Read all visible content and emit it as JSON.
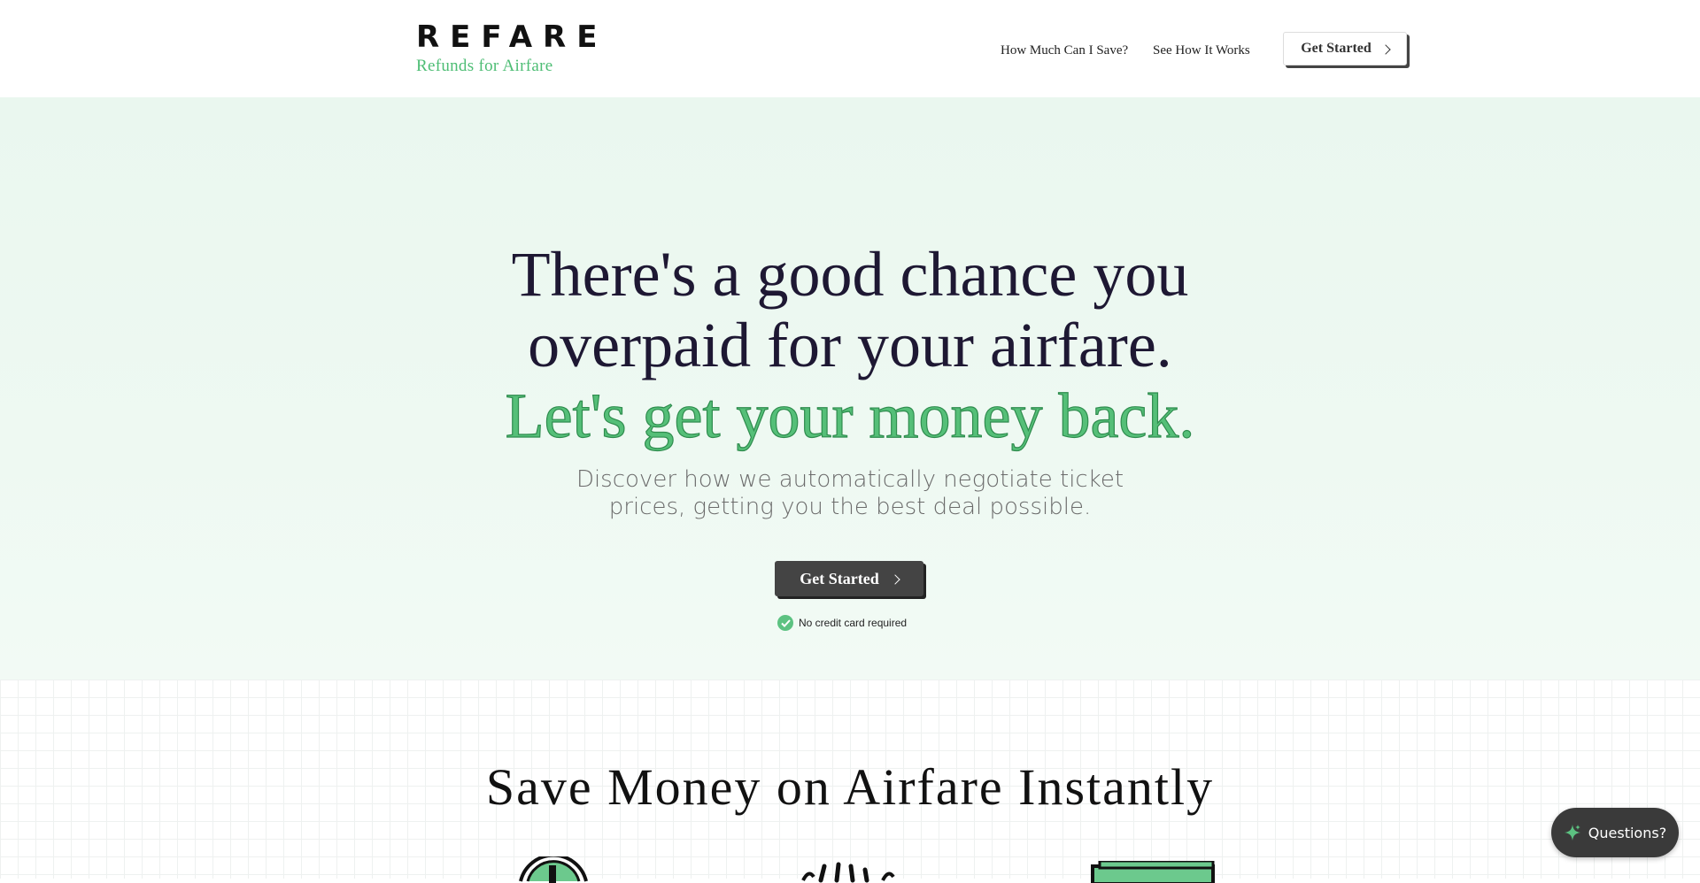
{
  "header": {
    "logo": "REFARE",
    "tagline": "Refunds for Airfare",
    "nav": {
      "save": "How Much Can I Save?",
      "how": "See How It Works"
    },
    "cta_label": "Get Started"
  },
  "hero": {
    "line1": "There's a good chance you",
    "line2": "overpaid for your airfare.",
    "line3": "Let's get your money back.",
    "sub1": "Discover how we automatically negotiate ticket",
    "sub2": "prices, getting you the best deal possible.",
    "cta_label": "Get Started",
    "note": "No credit card required"
  },
  "section": {
    "title": "Save Money on Airfare Instantly"
  },
  "chat": {
    "label": "Questions?"
  },
  "colors": {
    "accent": "#55bf78",
    "dark": "#1e1833",
    "button": "#444444"
  },
  "icons": [
    "check-icon",
    "chevron-right-icon",
    "sparkle-icon",
    "clock-icon",
    "hands-icon",
    "money-icon"
  ]
}
